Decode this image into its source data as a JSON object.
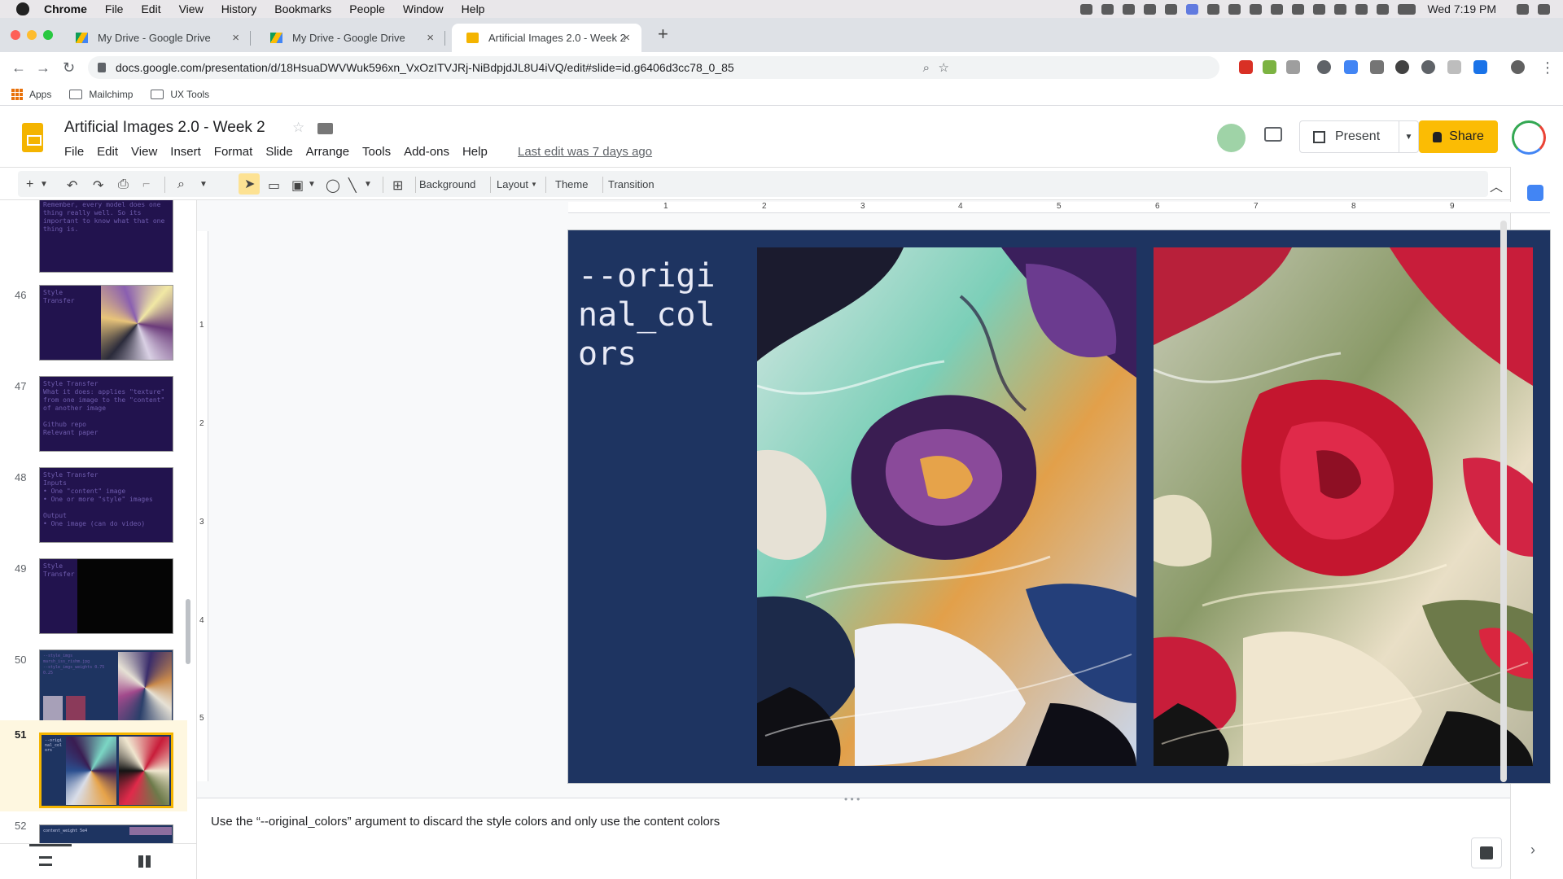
{
  "mac_menu": {
    "items": [
      "Chrome",
      "File",
      "Edit",
      "View",
      "History",
      "Bookmarks",
      "People",
      "Window",
      "Help"
    ],
    "clock": "Wed 7:19 PM"
  },
  "browser": {
    "tabs": [
      {
        "title": "My Drive - Google Drive",
        "close": "×"
      },
      {
        "title": "My Drive - Google Drive",
        "close": "×"
      },
      {
        "title": "Artificial Images 2.0 - Week 2",
        "close": "×"
      }
    ],
    "new_tab": "+",
    "url": "docs.google.com/presentation/d/18HsuaDWVWuk596xn_VxOzITVJRj-NiBdpjdJL8U4iVQ/edit#slide=id.g6406d3cc78_0_85",
    "bookmarks": [
      "Apps",
      "Mailchimp",
      "UX Tools"
    ]
  },
  "doc": {
    "title": "Artificial Images 2.0 - Week 2",
    "menu": [
      "File",
      "Edit",
      "View",
      "Insert",
      "Format",
      "Slide",
      "Arrange",
      "Tools",
      "Add-ons",
      "Help"
    ],
    "last_edit": "Last edit was 7 days ago",
    "present_label": "Present",
    "share_label": "Share"
  },
  "toolbar": {
    "background": "Background",
    "layout": "Layout",
    "theme": "Theme",
    "transition": "Transition"
  },
  "ruler": {
    "h": [
      "1",
      "2",
      "3",
      "4",
      "5",
      "6",
      "7",
      "8",
      "9"
    ],
    "v": [
      "1",
      "2",
      "3",
      "4",
      "5"
    ]
  },
  "filmstrip": {
    "slides": [
      {
        "num": "",
        "text": "Remember, every model does one\nthing really well. So its\nimportant to know what that one\nthing is."
      },
      {
        "num": "46",
        "text": "Style\nTransfer"
      },
      {
        "num": "47",
        "text": "Style Transfer\nWhat it does: applies \"texture\"\nfrom one image to the \"content\"\nof another image\n\nGithub repo\nRelevant paper"
      },
      {
        "num": "48",
        "text": "Style Transfer\nInputs\n• One \"content\" image\n• One or more \"style\" images\n\nOutput\n• One image (can do video)"
      },
      {
        "num": "49",
        "text": "Style\nTransfer"
      },
      {
        "num": "50",
        "text": "--style_imgs\nmarsh_iss_rishm.jpg\n--style_imgs_weights 0.75\n0.25"
      },
      {
        "num": "51",
        "text": "--origi\nnal_col\nors"
      },
      {
        "num": "52",
        "text": "content_weight 5e4"
      }
    ]
  },
  "slide": {
    "text": "--original_colors"
  },
  "notes": {
    "text": "Use the “--original_colors” argument to discard the style colors and only use the content colors"
  }
}
